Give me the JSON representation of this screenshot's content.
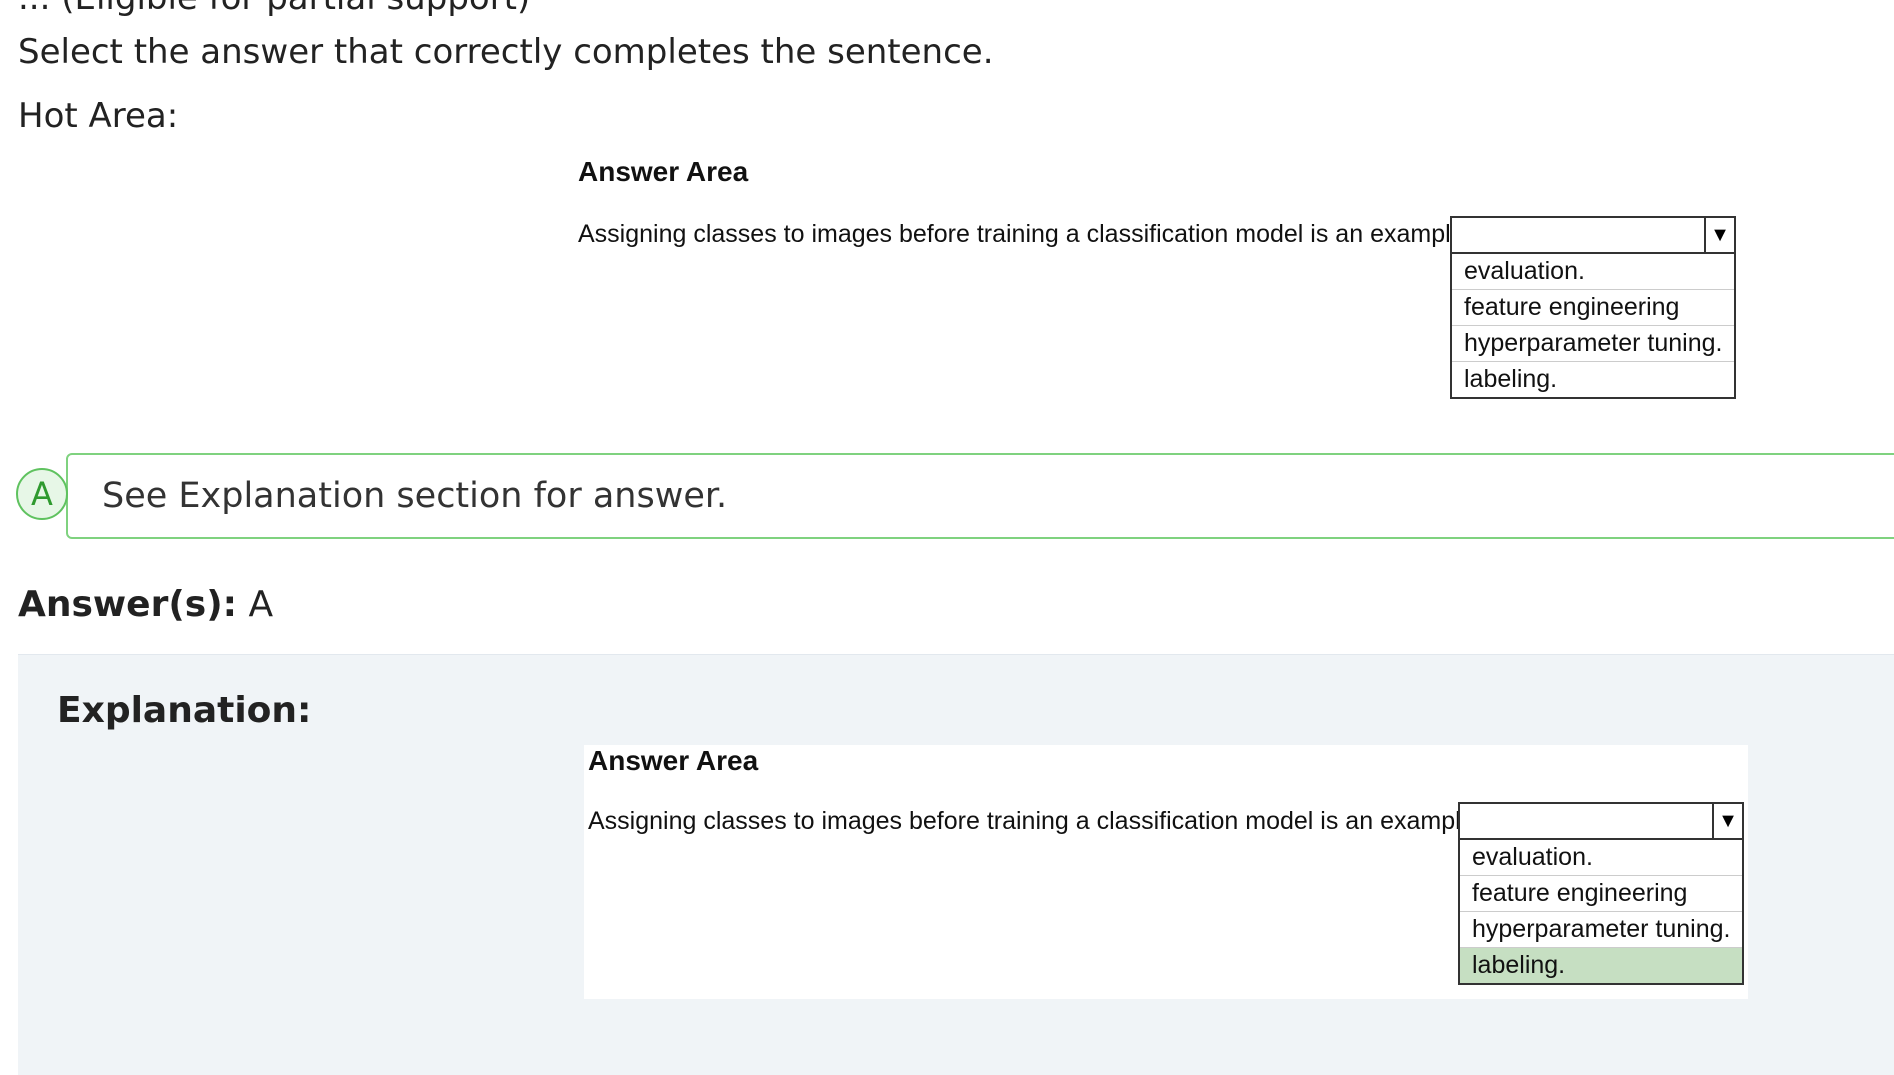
{
  "question": {
    "cut_text": "... (Eligible for partial support)",
    "prompt": "Select the answer that correctly completes the sentence.",
    "hot_area_label": "Hot Area:"
  },
  "hot_area": {
    "title": "Answer Area",
    "sentence": "Assigning classes to images before training a classification model is an example of",
    "options": [
      "evaluation.",
      "feature engineering",
      "hyperparameter tuning.",
      "labeling."
    ]
  },
  "answer_choice": {
    "letter": "A",
    "text": "See Explanation section for answer."
  },
  "answers": {
    "label": "Answer(s):",
    "value": "A"
  },
  "explanation": {
    "title": "Explanation:",
    "area_title": "Answer Area",
    "sentence": "Assigning classes to images before training a classification model is an example of",
    "options": [
      "evaluation.",
      "feature engineering",
      "hyperparameter tuning.",
      "labeling."
    ],
    "selected_option": "labeling."
  }
}
